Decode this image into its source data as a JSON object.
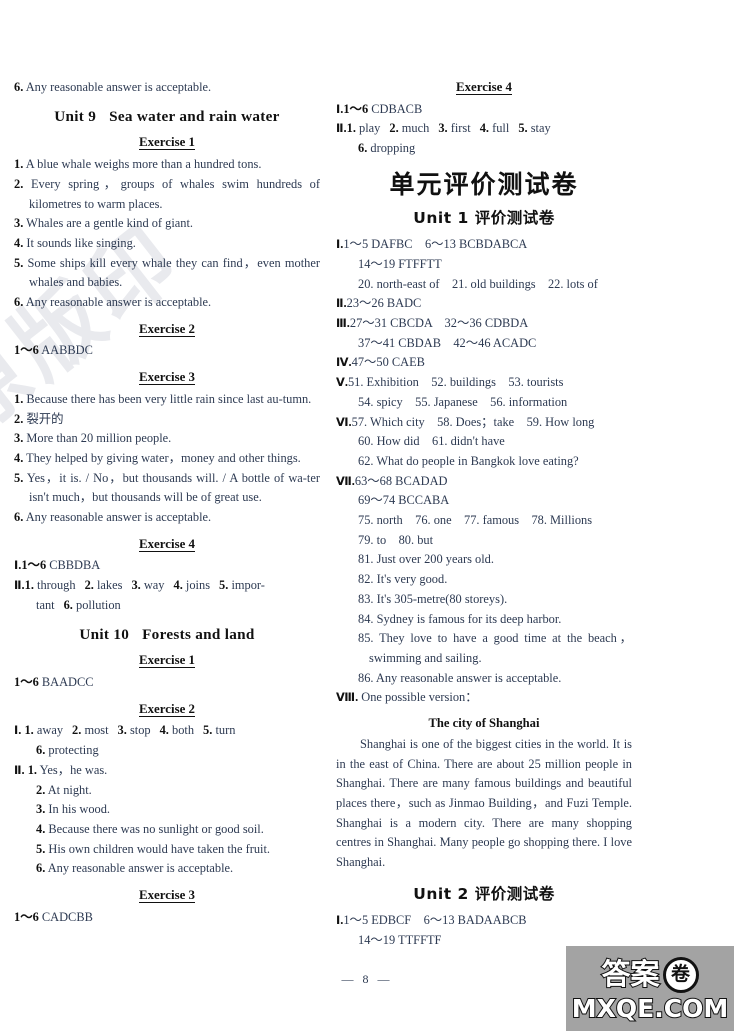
{
  "page": {
    "number": "— 8 —",
    "watermark_diagonal": "原版印",
    "logo": {
      "cn": "答案",
      "circle": "卷",
      "domain": "MXQE.COM"
    }
  },
  "left_column": {
    "top_answer": {
      "num": "6.",
      "text": "Any reasonable answer is acceptable."
    },
    "unit9": {
      "title_unit": "Unit 9",
      "title_name": "Sea water and rain water",
      "exercise1": {
        "title": "Exercise 1",
        "items": [
          {
            "num": "1.",
            "text": "A blue whale weighs more than a hundred tons."
          },
          {
            "num": "2.",
            "text": "Every spring，groups of whales swim hundreds of kilometres to warm places."
          },
          {
            "num": "3.",
            "text": "Whales are a gentle kind of giant."
          },
          {
            "num": "4.",
            "text": "It sounds like singing."
          },
          {
            "num": "5.",
            "text": "Some ships kill every whale they can find，even mother whales and babies."
          },
          {
            "num": "6.",
            "text": "Any reasonable answer is acceptable."
          }
        ]
      },
      "exercise2": {
        "title": "Exercise 2",
        "range": "1～6",
        "answers": "AABBDC"
      },
      "exercise3": {
        "title": "Exercise 3",
        "items": [
          {
            "num": "1.",
            "text": "Because there has been very little rain since last au-tumn."
          },
          {
            "num": "2.",
            "text": "裂开的"
          },
          {
            "num": "3.",
            "text": "More than 20 million people."
          },
          {
            "num": "4.",
            "text": "They helped by giving water，money and other things."
          },
          {
            "num": "5.",
            "text": "Yes，it is. / No，but thousands will. / A bottle of wa-ter isn't much，but thousands will be of great use."
          },
          {
            "num": "6.",
            "text": "Any reasonable answer is acceptable."
          }
        ]
      },
      "exercise4": {
        "title": "Exercise 4",
        "part1": {
          "rn": "Ⅰ",
          "range": "1～6",
          "answers": "CBBDBA"
        },
        "part2": {
          "rn": "Ⅱ",
          "items": [
            {
              "num": "1.",
              "text": "through"
            },
            {
              "num": "2.",
              "text": "lakes"
            },
            {
              "num": "3.",
              "text": "way"
            },
            {
              "num": "4.",
              "text": "joins"
            },
            {
              "num": "5.",
              "text": "impor-"
            },
            {
              "num": "",
              "text": "tant"
            },
            {
              "num": "6.",
              "text": "pollution"
            }
          ]
        }
      }
    },
    "unit10": {
      "title_unit": "Unit 10",
      "title_name": "Forests and land",
      "exercise1": {
        "title": "Exercise 1",
        "range": "1～6",
        "answers": "BAADCC"
      },
      "exercise2": {
        "title": "Exercise 2",
        "part1": {
          "rn": "Ⅰ",
          "items": [
            {
              "num": "1.",
              "text": "away"
            },
            {
              "num": "2.",
              "text": "most"
            },
            {
              "num": "3.",
              "text": "stop"
            },
            {
              "num": "4.",
              "text": "both"
            },
            {
              "num": "5.",
              "text": "turn"
            },
            {
              "num": "6.",
              "text": "protecting"
            }
          ]
        },
        "part2": {
          "rn": "Ⅱ",
          "items": [
            {
              "num": "1.",
              "text": "Yes，he was."
            },
            {
              "num": "2.",
              "text": "At night."
            },
            {
              "num": "3.",
              "text": "In his wood."
            },
            {
              "num": "4.",
              "text": "Because there was no sunlight or good soil."
            },
            {
              "num": "5.",
              "text": "His own children would have taken the fruit."
            },
            {
              "num": "6.",
              "text": "Any reasonable answer is acceptable."
            }
          ]
        }
      },
      "exercise3": {
        "title": "Exercise 3",
        "range": "1～6",
        "answers": "CADCBB"
      }
    }
  },
  "right_column": {
    "exercise4": {
      "title": "Exercise 4",
      "part1": {
        "rn": "Ⅰ",
        "range": "1～6",
        "answers": "CDBACB"
      },
      "part2": {
        "rn": "Ⅱ",
        "items": [
          {
            "num": "1.",
            "text": "play"
          },
          {
            "num": "2.",
            "text": "much"
          },
          {
            "num": "3.",
            "text": "first"
          },
          {
            "num": "4.",
            "text": "full"
          },
          {
            "num": "5.",
            "text": "stay"
          },
          {
            "num": "6.",
            "text": "dropping"
          }
        ]
      }
    },
    "main_title": "单元评价测试卷",
    "unit1": {
      "title": "Unit 1 评价测试卷",
      "lines": [
        {
          "rn": "Ⅰ",
          "content": "1～5 DAFBC　6～13 BCBDABCA"
        },
        {
          "rn": "",
          "content": "14～19 FTFFTT"
        },
        {
          "rn": "",
          "content": "20. north-east of　21. old buildings　22. lots of"
        },
        {
          "rn": "Ⅱ",
          "content": "23～26 BADC"
        },
        {
          "rn": "Ⅲ",
          "content": "27～31 CBCDA　32～36 CDBDA"
        },
        {
          "rn": "",
          "content": "37～41 CBDAB　42～46 ACADC"
        },
        {
          "rn": "Ⅳ",
          "content": "47～50 CAEB"
        },
        {
          "rn": "Ⅴ",
          "content": "51. Exhibition　52. buildings　53. tourists"
        },
        {
          "rn": "",
          "content": "54. spicy　55. Japanese　56. information"
        },
        {
          "rn": "Ⅵ",
          "content": "57. Which city　58. Does；take　59. How long"
        },
        {
          "rn": "",
          "content": "60. How did　61. didn't have"
        },
        {
          "rn": "",
          "content": "62. What do people in Bangkok love eating?"
        },
        {
          "rn": "Ⅶ",
          "content": "63～68 BCADAD"
        },
        {
          "rn": "",
          "content": "69～74 BCCABA"
        },
        {
          "rn": "",
          "content": "75. north　76. one　77. famous　78. Millions"
        },
        {
          "rn": "",
          "content": "79. to　80. but"
        },
        {
          "rn": "",
          "content": "81. Just over 200 years old."
        },
        {
          "rn": "",
          "content": "82. It's very good."
        },
        {
          "rn": "",
          "content": "83. It's 305-metre(80 storeys)."
        },
        {
          "rn": "",
          "content": "84. Sydney is famous for its deep harbor."
        },
        {
          "rn": "",
          "content": "85. They love to have a good time at the beach，swimming and sailing."
        },
        {
          "rn": "",
          "content": "86. Any reasonable answer is acceptable."
        },
        {
          "rn": "Ⅷ",
          "content": "One possible version："
        }
      ],
      "composition": {
        "title": "The city of Shanghai",
        "body": "Shanghai is one of the biggest cities in the world. It is in the east of China. There are about 25 million people in Shanghai. There are many famous buildings and beautiful places there，such as Jinmao Building，and Fuzi Temple. Shanghai is a modern city. There are many shopping centres in Shanghai. Many people go shopping there. I love Shanghai."
      }
    },
    "unit2": {
      "title": "Unit 2 评价测试卷",
      "lines": [
        {
          "rn": "Ⅰ",
          "content": "1～5 EDBCF　6～13 BADAABCB"
        },
        {
          "rn": "",
          "content": "14～19 TTFFTF"
        }
      ]
    }
  }
}
